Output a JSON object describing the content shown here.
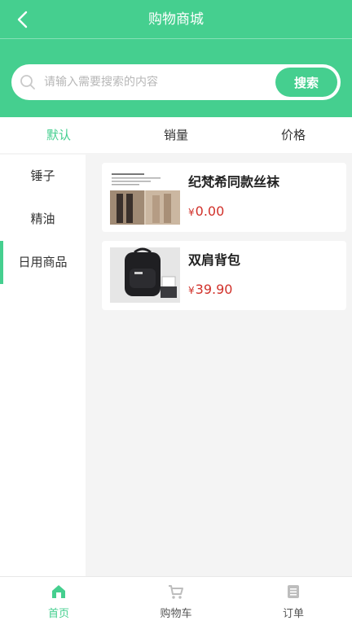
{
  "header": {
    "title": "购物商城",
    "back_icon": "chevron-left-icon"
  },
  "search": {
    "placeholder": "请输入需要搜索的内容",
    "value": "",
    "button_label": "搜索"
  },
  "sort_tabs": [
    {
      "label": "默认",
      "active": true
    },
    {
      "label": "销量",
      "active": false
    },
    {
      "label": "价格",
      "active": false
    }
  ],
  "categories": [
    {
      "label": "锤子",
      "active": false
    },
    {
      "label": "精油",
      "active": false
    },
    {
      "label": "日用商品",
      "active": true
    }
  ],
  "products": [
    {
      "name": "纪梵希同款丝袜",
      "currency": "¥",
      "price": "0.00",
      "image": "stockings-photo"
    },
    {
      "name": "双肩背包",
      "currency": "¥",
      "price": "39.90",
      "image": "backpack-photo"
    }
  ],
  "tabbar": [
    {
      "label": "首页",
      "icon": "home-icon",
      "active": true
    },
    {
      "label": "购物车",
      "icon": "cart-icon",
      "active": false
    },
    {
      "label": "订单",
      "icon": "order-icon",
      "active": false
    }
  ],
  "colors": {
    "accent": "#45cf8f",
    "price": "#d1312a",
    "background": "#f4f4f4"
  }
}
